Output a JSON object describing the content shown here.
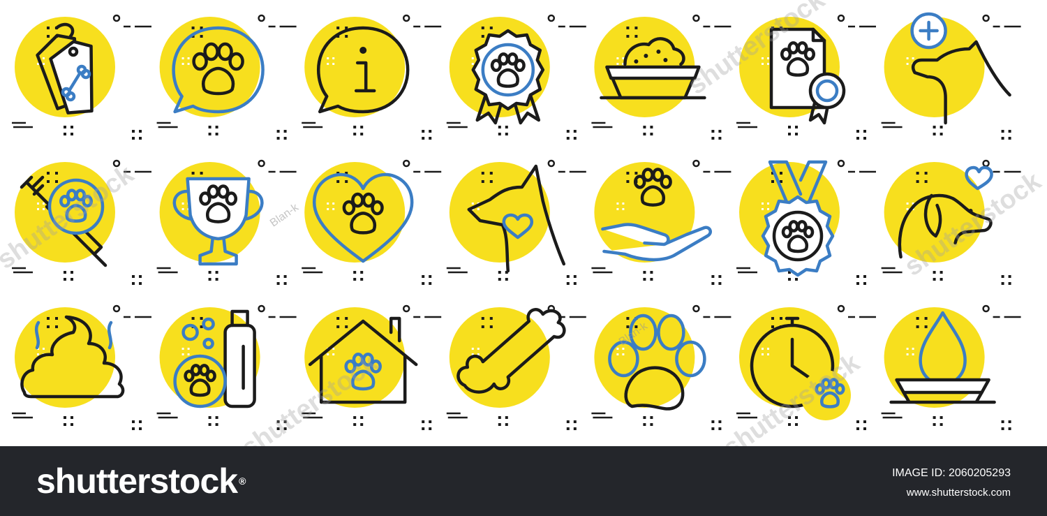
{
  "icons": [
    {
      "name": "price-tags-bone-icon",
      "kind": "tags"
    },
    {
      "name": "paw-speech-bubble-icon",
      "kind": "pawbubble"
    },
    {
      "name": "info-bubble-icon",
      "kind": "info"
    },
    {
      "name": "paw-rosette-award-icon",
      "kind": "rosette"
    },
    {
      "name": "pet-food-bowl-icon",
      "kind": "bowl"
    },
    {
      "name": "pet-certificate-icon",
      "kind": "certificate"
    },
    {
      "name": "dog-vet-cross-icon",
      "kind": "dogvet"
    },
    {
      "name": "syringe-paw-vaccine-icon",
      "kind": "syringe"
    },
    {
      "name": "paw-trophy-cup-icon",
      "kind": "trophy"
    },
    {
      "name": "paw-heart-icon",
      "kind": "heart"
    },
    {
      "name": "cat-heart-icon",
      "kind": "cat"
    },
    {
      "name": "paw-hand-care-icon",
      "kind": "hand"
    },
    {
      "name": "paw-medal-icon",
      "kind": "medal"
    },
    {
      "name": "dog-love-icon",
      "kind": "doglove"
    },
    {
      "name": "dog-poop-icon",
      "kind": "poop"
    },
    {
      "name": "pet-shampoo-icon",
      "kind": "shampoo"
    },
    {
      "name": "pet-house-icon",
      "kind": "house"
    },
    {
      "name": "dog-bone-icon",
      "kind": "bone"
    },
    {
      "name": "paw-print-icon",
      "kind": "paw"
    },
    {
      "name": "walk-timer-paws-icon",
      "kind": "timer"
    },
    {
      "name": "water-bowl-icon",
      "kind": "water"
    }
  ],
  "colors": {
    "yellow": "#f7df1e",
    "line": "#1b1b1b",
    "accent": "#3b7dc4",
    "footer": "#24262b",
    "footer_text": "#ffffff"
  },
  "watermark": {
    "text": "shutterstock",
    "author": "Blan-k"
  },
  "footer": {
    "logo": "shutterstock",
    "logo_mark": "®",
    "image_id": "IMAGE ID: 2060205293",
    "site": "www.shutterstock.com"
  }
}
